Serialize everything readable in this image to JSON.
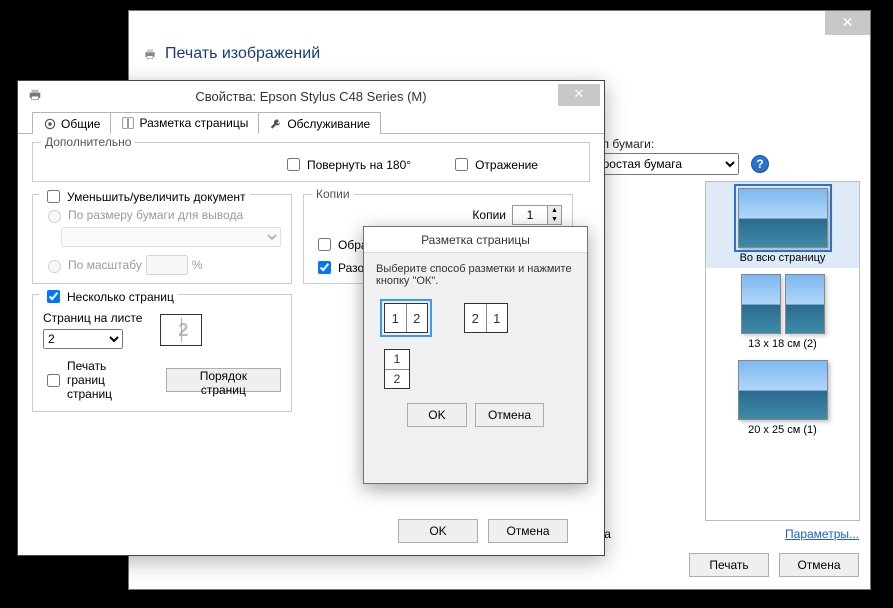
{
  "outer": {
    "title": "Печать изображений",
    "paper_type_label": "Тип бумаги:",
    "paper_type_value": "Простая бумага",
    "frame_label": "у кадра",
    "params_link": "Параметры...",
    "print_btn": "Печать",
    "cancel_btn": "Отмена",
    "thumbs": [
      {
        "label": "Во всю страницу",
        "selected": true,
        "split": false
      },
      {
        "label": "13 x 18 см (2)",
        "selected": false,
        "split": true
      },
      {
        "label": "20 x 25 см (1)",
        "selected": false,
        "split": false
      }
    ]
  },
  "props": {
    "title": "Свойства: Epson Stylus C48 Series (M)",
    "tabs": [
      {
        "label": "Общие",
        "active": false
      },
      {
        "label": "Разметка страницы",
        "active": true
      },
      {
        "label": "Обслуживание",
        "active": false
      }
    ],
    "extra_legend": "Дополнительно",
    "rotate_label": "Повернуть на 180°",
    "mirror_label": "Отражение",
    "shrink_legend": "Уменьшить/увеличить документ",
    "fit_paper": "По размеру бумаги для вывода",
    "by_scale": "По масштабу",
    "scale_value": "",
    "copies_legend": "Копии",
    "copies_label": "Копии",
    "copies_value": "1",
    "reverse_order": "Обратны",
    "collate": "Разобрат",
    "multipage_legend": "Несколько страниц",
    "pages_per_sheet": "Страниц на листе",
    "pages_value": "2",
    "print_borders": "Печать границ\nстраниц",
    "page_order_btn": "Порядок страниц",
    "ok_btn": "OK",
    "cancel_btn": "Отмена"
  },
  "dialog": {
    "title": "Разметка страницы",
    "message": "Выберите способ разметки и нажмите кнопку \"ОК\".",
    "ok_btn": "OK",
    "cancel_btn": "Отмена"
  }
}
